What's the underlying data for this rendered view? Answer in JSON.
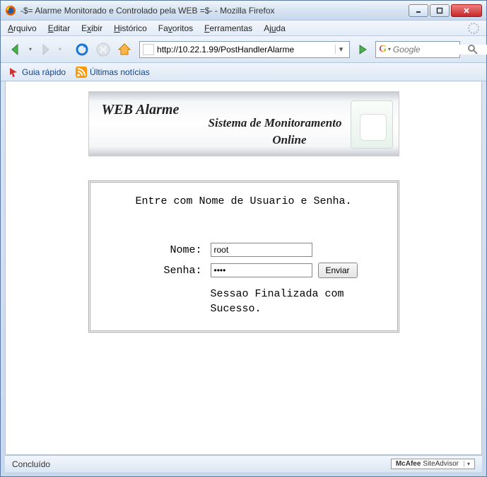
{
  "window": {
    "title": "-$= Alarme Monitorado e Controlado pela WEB =$- - Mozilla Firefox"
  },
  "menu": {
    "arquivo": "Arquivo",
    "editar": "Editar",
    "exibir": "Exibir",
    "historico": "Histórico",
    "favoritos": "Favoritos",
    "ferramentas": "Ferramentas",
    "ajuda": "Ajuda"
  },
  "nav": {
    "url": "http://10.22.1.99/PostHandlerAlarme",
    "search_placeholder": "Google"
  },
  "bookmarks": {
    "guia": "Guia rápido",
    "noticias": "Últimas notícias"
  },
  "banner": {
    "brand": "WEB Alarme",
    "line1": "Sistema de Monitoramento",
    "line2": "Online"
  },
  "login": {
    "heading": "Entre com Nome de Usuario e Senha.",
    "nome_label": "Nome:",
    "senha_label": "Senha:",
    "nome_value": "root",
    "senha_value": "****",
    "submit": "Enviar",
    "status": "Sessao Finalizada com Sucesso."
  },
  "status": {
    "text": "Concluído",
    "siteadvisor_bold": "McAfee",
    "siteadvisor_rest": " SiteAdvisor"
  }
}
